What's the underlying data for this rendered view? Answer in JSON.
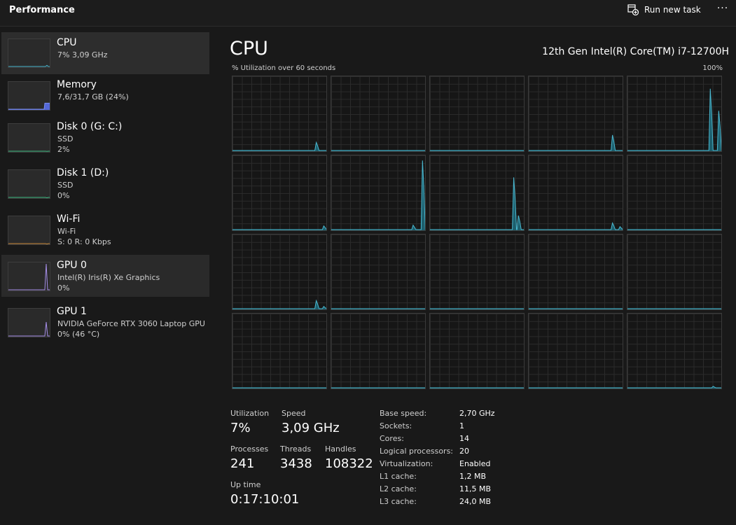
{
  "titlebar": {
    "title": "Performance",
    "run_new_task_label": "Run new task",
    "more_label": "···"
  },
  "sidebar": {
    "items": [
      {
        "name": "CPU",
        "line1": "7% 3,09 GHz",
        "line2": "",
        "graph_color": "#4ab8d0",
        "fill": "#1a4a55",
        "peak": 0.07,
        "selected": true
      },
      {
        "name": "Memory",
        "line1": "7,6/31,7 GB (24%)",
        "line2": "",
        "graph_color": "#7b8ff0",
        "fill": "#5468d8",
        "peak": 0.24
      },
      {
        "name": "Disk 0 (G: C:)",
        "line1": "SSD",
        "line2": "2%",
        "graph_color": "#3fb982",
        "fill": "#1d4a36",
        "peak": 0.02
      },
      {
        "name": "Disk 1 (D:)",
        "line1": "SSD",
        "line2": "0%",
        "graph_color": "#3fb982",
        "fill": "#1d4a36",
        "peak": 0.0
      },
      {
        "name": "Wi-Fi",
        "line1": "Wi-Fi",
        "line2": "S: 0 R: 0 Kbps",
        "graph_color": "#c98a3b",
        "fill": "#4a3318",
        "peak": 0.0
      },
      {
        "name": "GPU 0",
        "line1": "Intel(R) Iris(R) Xe Graphics",
        "line2": "0%",
        "graph_color": "#a58ee8",
        "fill": "#3d2f66",
        "peak": 1.0
      },
      {
        "name": "GPU 1",
        "line1": "NVIDIA GeForce RTX 3060 Laptop GPU",
        "line2": "0% (46 °C)",
        "graph_color": "#a58ee8",
        "fill": "#3d2f66",
        "peak": 0.55
      }
    ]
  },
  "main": {
    "title": "CPU",
    "model": "12th Gen Intel(R) Core(TM) i7-12700H",
    "graph_label": "% Utilization over 60 seconds",
    "graph_max": "100%",
    "graph_color": "#4ab8d0",
    "graph_fill": "#1d5f6d",
    "cores": [
      {
        "peaks": [
          [
            0.9,
            0.12
          ]
        ]
      },
      {
        "peaks": []
      },
      {
        "peaks": []
      },
      {
        "peaks": [
          [
            0.9,
            0.22
          ]
        ]
      },
      {
        "peaks": [
          [
            0.89,
            0.85
          ],
          [
            0.98,
            0.55
          ]
        ]
      },
      {
        "peaks": [
          [
            0.98,
            0.06
          ]
        ]
      },
      {
        "peaks": [
          [
            0.88,
            0.07
          ],
          [
            0.98,
            0.95
          ]
        ]
      },
      {
        "peaks": [
          [
            0.9,
            0.72
          ],
          [
            0.95,
            0.2
          ]
        ]
      },
      {
        "peaks": [
          [
            0.9,
            0.1
          ],
          [
            0.98,
            0.05
          ]
        ]
      },
      {
        "peaks": []
      },
      {
        "peaks": [
          [
            0.9,
            0.12
          ],
          [
            0.98,
            0.04
          ]
        ]
      },
      {
        "peaks": []
      },
      {
        "peaks": []
      },
      {
        "peaks": []
      },
      {
        "peaks": []
      },
      {
        "peaks": []
      },
      {
        "peaks": []
      },
      {
        "peaks": []
      },
      {
        "peaks": []
      },
      {
        "peaks": [
          [
            0.92,
            0.03
          ]
        ]
      }
    ]
  },
  "stats": {
    "utilization_label": "Utilization",
    "utilization": "7%",
    "speed_label": "Speed",
    "speed": "3,09 GHz",
    "processes_label": "Processes",
    "processes": "241",
    "threads_label": "Threads",
    "threads": "3438",
    "handles_label": "Handles",
    "handles": "108322",
    "uptime_label": "Up time",
    "uptime": "0:17:10:01"
  },
  "details": [
    {
      "key": "Base speed:",
      "value": "2,70 GHz"
    },
    {
      "key": "Sockets:",
      "value": "1"
    },
    {
      "key": "Cores:",
      "value": "14"
    },
    {
      "key": "Logical processors:",
      "value": "20"
    },
    {
      "key": "Virtualization:",
      "value": "Enabled"
    },
    {
      "key": "L1 cache:",
      "value": "1,2 MB"
    },
    {
      "key": "L2 cache:",
      "value": "11,5 MB"
    },
    {
      "key": "L3 cache:",
      "value": "24,0 MB"
    }
  ]
}
